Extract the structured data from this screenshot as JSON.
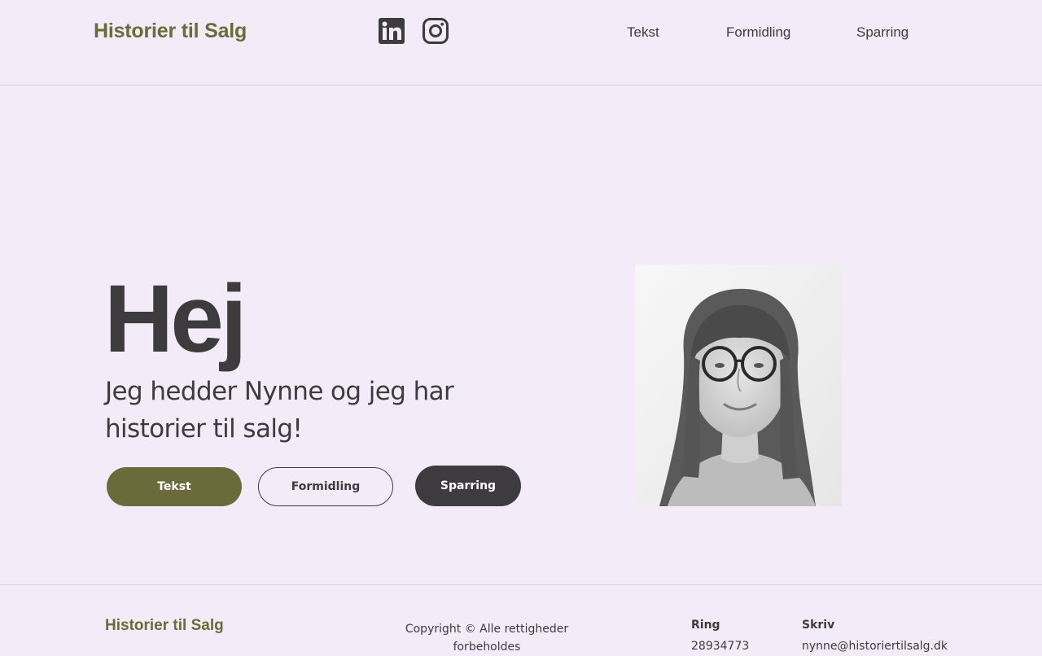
{
  "header": {
    "logo": "Historier til Salg",
    "social": [
      {
        "icon": "linkedin-icon"
      },
      {
        "icon": "instagram-icon"
      }
    ],
    "nav": [
      "Tekst",
      "Formidling",
      "Sparring"
    ]
  },
  "hero": {
    "title": "Hej",
    "subtitle": "Jeg hedder Nynne og jeg har historier til salg!",
    "buttons": [
      "Tekst",
      "Formidling",
      "Sparring"
    ]
  },
  "footer": {
    "logo": "Historier til Salg",
    "copyright": "Copyright © Alle rettigheder forbeholdes",
    "contact": [
      {
        "label": "Ring",
        "value": "28934773"
      },
      {
        "label": "Skriv",
        "value": "nynne@historiertilsalg.dk"
      }
    ]
  },
  "colors": {
    "background": "#f3ebf7",
    "brand_olive": "#6b6a3a",
    "dark": "#3d3b3d",
    "divider": "#d6d0db"
  }
}
